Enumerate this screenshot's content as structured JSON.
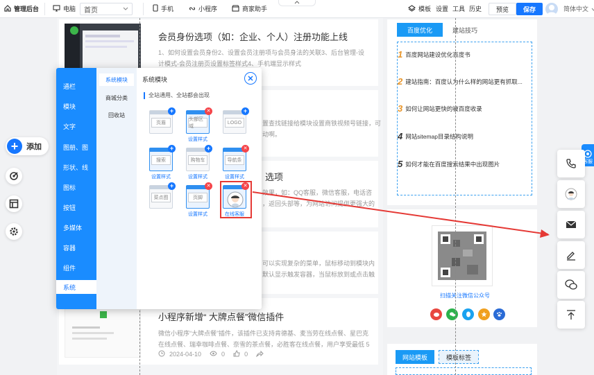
{
  "topbar": {
    "admin": "管理后台",
    "device": "电脑",
    "page_select": "首页",
    "mobile": "手机",
    "miniprogram": "小程序",
    "merchant": "商家助手",
    "template": "模板",
    "settings": "设置",
    "tools": "工具",
    "history": "历史",
    "preview": "预览",
    "save": "保存",
    "language": "简体中文"
  },
  "left_tools": {
    "add_label": "添加"
  },
  "articles": [
    {
      "title": "会员身份选项（如：企业、个人）注册功能上线",
      "text": "1、如何设置会员身份2、设置会员注册项与会员身法的关联3、后台管理-设计模式-会员注册页设置标签样式4、手机端显示样式"
    },
    {
      "text_a": "置查找链接给模块设置商铁视频号链接，可",
      "text_b": "动啊。"
    },
    {
      "title_frag": "选项",
      "text_a": "效果，如：QQ客服，微信客服，电话咨",
      "text_b": "，返回头部等，为网站访问提供更强大的"
    },
    {
      "text_a": "可以实现复杂的菜单，鼠标移动到模块内",
      "text_b": "默认显示触发容器，当鼠标放到或点击触"
    },
    {
      "title": "小程序新增“ 大牌点餐”微信插件",
      "text": "微信小程序“大牌点餐”插件，该插件已支持肯德基、麦当劳在线点餐、星巴克在线点餐、瑞幸咖啡点餐、奈雪的茶点餐，必胜客在线点餐，用户享受最低 5 折起点餐。",
      "date": "2024-04-10",
      "views": "0",
      "likes": "0"
    }
  ],
  "panel": {
    "categories": [
      "通栏",
      "模块",
      "文字",
      "图册、图",
      "形状、线",
      "图标",
      "按钮",
      "多媒体",
      "容器",
      "组件",
      "系统"
    ],
    "active_category": "系统",
    "subcategories": [
      "系统模块",
      "商城分类",
      "回收站"
    ],
    "title": "系统模块",
    "subtitle": "全站通用、全站都会出现",
    "tiles": [
      {
        "label": "页眉",
        "caption": ""
      },
      {
        "label": "头部区域",
        "caption": "设置样式"
      },
      {
        "label": "LOGO",
        "caption": ""
      },
      {
        "label": "搜索",
        "caption": "设置样式"
      },
      {
        "label": "购物车",
        "caption": "设置样式"
      },
      {
        "label": "导航条",
        "caption": "设置样式"
      },
      {
        "label": "菜点图",
        "caption": ""
      },
      {
        "label": "页脚",
        "caption": "设置样式"
      },
      {
        "label": "",
        "caption": "在线客服"
      }
    ]
  },
  "sidebar": {
    "tab_active": "百度优化",
    "tab_other": "建站技巧",
    "tips": [
      {
        "n": "1",
        "text": "百度网站建设优化百度书"
      },
      {
        "n": "2",
        "text": "建站指南：百度认为什么样的网站更有抓取..."
      },
      {
        "n": "3",
        "text": "如何让网站更快的被百度收录"
      },
      {
        "n": "4",
        "text": "网站sitemap目录结构说明"
      },
      {
        "n": "5",
        "text": "如何才能在百度搜索结果中出现图片"
      }
    ],
    "qr_caption": "扫描关注微信公众号",
    "bottom_tab_active": "网站模板",
    "bottom_tab_other": "模板标签"
  },
  "float": {
    "kefu": "客服"
  },
  "colors": {
    "accent": "#1677ff",
    "danger": "#e53935"
  }
}
